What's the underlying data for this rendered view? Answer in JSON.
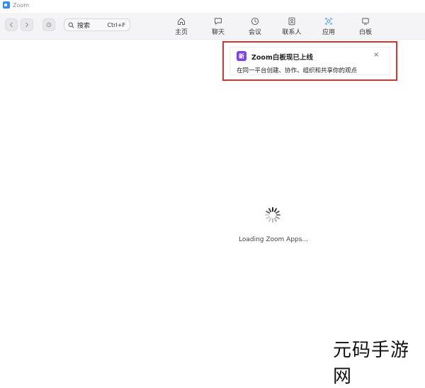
{
  "app": {
    "title": "Zoom"
  },
  "toolbar": {
    "search_label": "搜索",
    "search_shortcut": "Ctrl+F"
  },
  "tabs": [
    {
      "label": "主页",
      "icon": "home-icon"
    },
    {
      "label": "聊天",
      "icon": "chat-icon"
    },
    {
      "label": "会议",
      "icon": "clock-icon"
    },
    {
      "label": "联系人",
      "icon": "contacts-icon"
    },
    {
      "label": "应用",
      "icon": "apps-icon",
      "active": true
    },
    {
      "label": "白板",
      "icon": "whiteboard-icon"
    }
  ],
  "notification": {
    "badge": "新",
    "title": "Zoom白板现已上线",
    "body": "在同一平台创建、协作、组织和共享你的观点",
    "close": "×"
  },
  "loading": {
    "text": "Loading Zoom Apps..."
  },
  "watermark": {
    "text": "元码手游网"
  },
  "colors": {
    "accent": "#2d8cff",
    "active_tab": "#2b8ef0",
    "badge": "#7a43e6",
    "highlight_frame": "#d6352f"
  }
}
